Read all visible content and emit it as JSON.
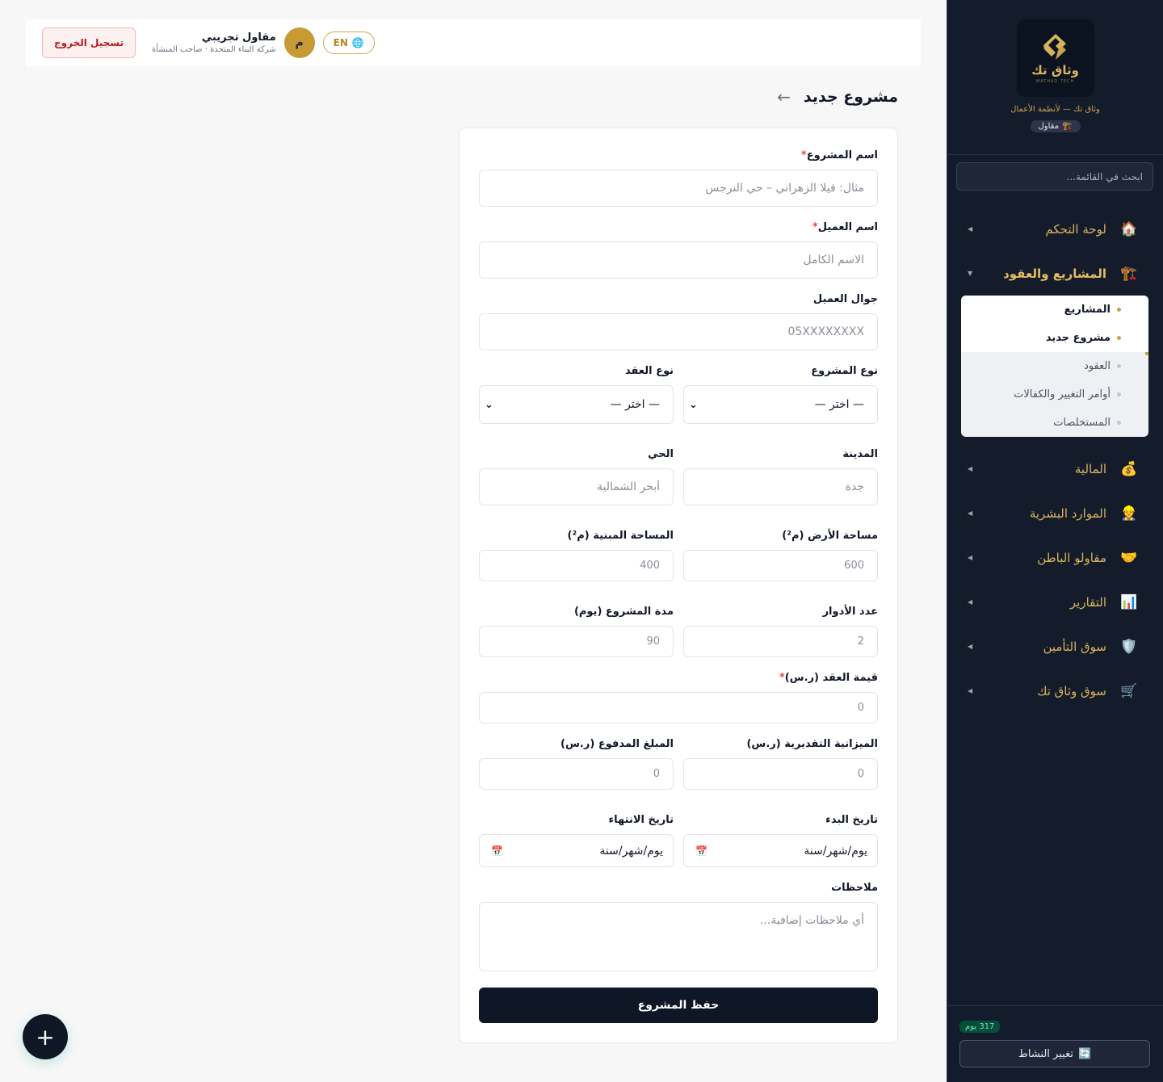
{
  "topbar": {
    "logout_label": "تسجيل الخروج",
    "user_name": "مقاول تجريبي",
    "user_company": "شركة البناء المتحدة · صاحب المنشأة",
    "avatar_letter": "م",
    "lang_label": "EN"
  },
  "page": {
    "title": "مشروع جديد",
    "back_icon": "arrow-left-icon"
  },
  "form": {
    "project_name": {
      "label": "اسم المشروع",
      "required": "*",
      "placeholder": "مثال: فيلا الزهراني – حي النرجس"
    },
    "client_name": {
      "label": "اسم العميل",
      "required": "*",
      "placeholder": "الاسم الكامل"
    },
    "client_mobile": {
      "label": "جوال العميل",
      "placeholder": "05XXXXXXXX"
    },
    "project_type": {
      "label": "نوع المشروع",
      "value": "— اختر —"
    },
    "contract_type": {
      "label": "نوع العقد",
      "value": "— اختر —"
    },
    "city": {
      "label": "المدينة",
      "placeholder": "جدة"
    },
    "district": {
      "label": "الحي",
      "placeholder": "أبحر الشمالية"
    },
    "land_area": {
      "label": "مساحة الأرض (م²)",
      "placeholder": "600"
    },
    "built_area": {
      "label": "المساحة المبنية (م²)",
      "placeholder": "400"
    },
    "floors": {
      "label": "عدد الأدوار",
      "placeholder": "2"
    },
    "duration": {
      "label": "مدة المشروع (يوم)",
      "placeholder": "90"
    },
    "contract_value": {
      "label": "قيمة العقد (ر.س)",
      "required": "*",
      "placeholder": "0"
    },
    "est_budget": {
      "label": "الميزانية التقديرية (ر.س)",
      "placeholder": "0"
    },
    "paid_amount": {
      "label": "المبلغ المدفوع (ر.س)",
      "placeholder": "0"
    },
    "start_date": {
      "label": "تاريخ البدء",
      "value": "يوم/شهر/سنة"
    },
    "end_date": {
      "label": "تاريخ الانتهاء",
      "value": "يوم/شهر/سنة"
    },
    "notes": {
      "label": "ملاحظات",
      "placeholder": "أي ملاحظات إضافية..."
    },
    "save_label": "حفظ المشروع"
  },
  "sidebar": {
    "brand_name": "وثاق تك",
    "brand_sub": "WATHAQ TECH",
    "tagline": "وثاق تك — لأنظمة الأعمال",
    "role_badge": "مقاول",
    "search_placeholder": "ابحث في القائمة...",
    "items": [
      {
        "label": "لوحة التحكم",
        "icon": "🏠"
      },
      {
        "label": "المشاريع والعقود",
        "icon": "🏗️"
      },
      {
        "label": "المالية",
        "icon": "💰"
      },
      {
        "label": "الموارد البشرية",
        "icon": "👷"
      },
      {
        "label": "مقاولو الباطن",
        "icon": "🤝"
      },
      {
        "label": "التقارير",
        "icon": "📊"
      },
      {
        "label": "سوق التأمين",
        "icon": "🛡️"
      },
      {
        "label": "سوق وثاق تك",
        "icon": "🛒"
      }
    ],
    "submenu": [
      "المشاريع",
      "مشروع جديد",
      "العقود",
      "أوامر التغيير والكفالات",
      "المستخلصات"
    ],
    "days_badge": "317 يوم",
    "switch_label": "تغيير النشاط"
  },
  "fab_label": "+",
  "colors": {
    "accent": "#c9a24a",
    "sidebar_bg": "#141c2c",
    "primary": "#0f1626"
  }
}
